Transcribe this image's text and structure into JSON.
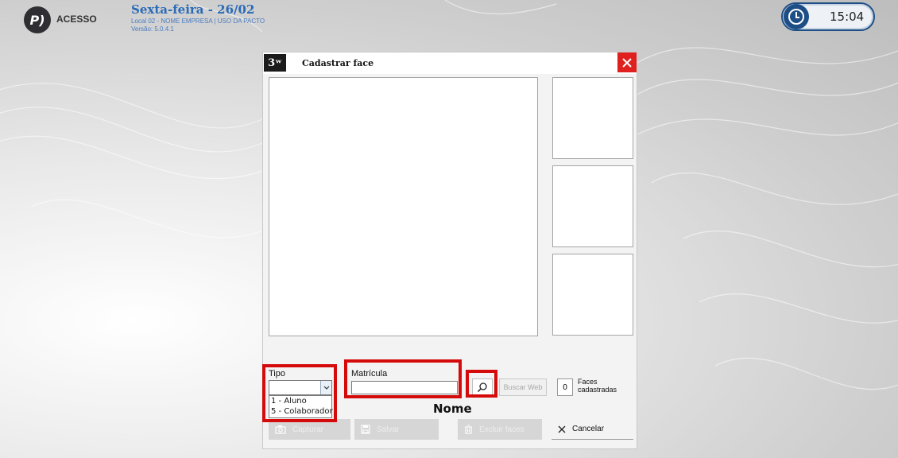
{
  "header": {
    "logo_mark": "P)",
    "app_name": "ACESSO",
    "date": "Sexta-feira  -  26/02",
    "local": "Local 02 - NOME EMPRESA | USO DA PACTO",
    "version": "Versão: 5.0.4.1",
    "time": "15:04"
  },
  "dialog": {
    "icon_text": "3ʷ",
    "title": "Cadastrar face",
    "tipo_label": "Tipo",
    "tipo_options": [
      "1 - Aluno",
      "5 - Colaborador"
    ],
    "matricula_label": "Matrícula",
    "matricula_value": "",
    "buscar_web_label": "Buscar Web",
    "faces_count": "0",
    "faces_label_line1": "Faces",
    "faces_label_line2": "cadastradas",
    "nome_label": "Nome",
    "buttons": {
      "capturar": "Capturar",
      "salvar": "Salvar",
      "excluir": "Excluir faces",
      "cancelar": "Cancelar"
    }
  },
  "colors": {
    "highlight": "#d50b0b",
    "close_red": "#e0201f",
    "header_blue": "#2a6ab6",
    "clock_blue": "#1d4f86"
  }
}
